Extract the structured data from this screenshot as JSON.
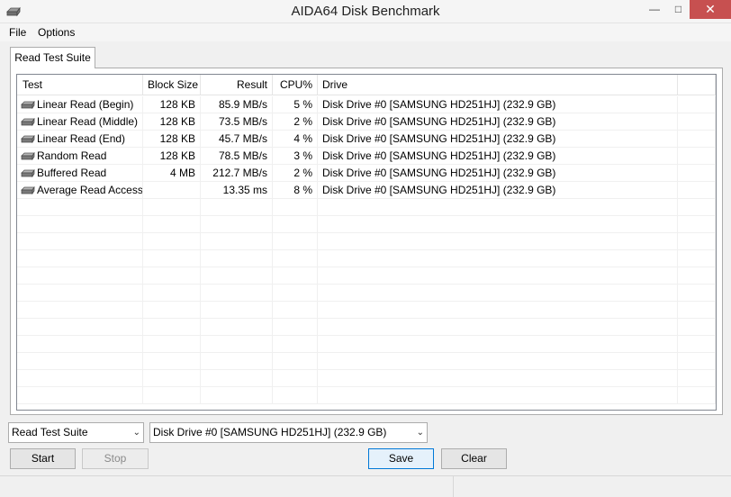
{
  "window": {
    "title": "AIDA64 Disk Benchmark"
  },
  "menu": {
    "file": "File",
    "options": "Options"
  },
  "tab": {
    "label": "Read Test Suite"
  },
  "table": {
    "headers": {
      "test": "Test",
      "block_size": "Block Size",
      "result": "Result",
      "cpu": "CPU%",
      "drive": "Drive"
    },
    "rows": [
      {
        "test": "Linear Read (Begin)",
        "block_size": "128 KB",
        "result": "85.9 MB/s",
        "cpu": "5 %",
        "drive": "Disk Drive #0  [SAMSUNG HD251HJ]  (232.9 GB)"
      },
      {
        "test": "Linear Read (Middle)",
        "block_size": "128 KB",
        "result": "73.5 MB/s",
        "cpu": "2 %",
        "drive": "Disk Drive #0  [SAMSUNG HD251HJ]  (232.9 GB)"
      },
      {
        "test": "Linear Read (End)",
        "block_size": "128 KB",
        "result": "45.7 MB/s",
        "cpu": "4 %",
        "drive": "Disk Drive #0  [SAMSUNG HD251HJ]  (232.9 GB)"
      },
      {
        "test": "Random Read",
        "block_size": "128 KB",
        "result": "78.5 MB/s",
        "cpu": "3 %",
        "drive": "Disk Drive #0  [SAMSUNG HD251HJ]  (232.9 GB)"
      },
      {
        "test": "Buffered Read",
        "block_size": "4 MB",
        "result": "212.7 MB/s",
        "cpu": "2 %",
        "drive": "Disk Drive #0  [SAMSUNG HD251HJ]  (232.9 GB)"
      },
      {
        "test": "Average Read Access",
        "block_size": "",
        "result": "13.35 ms",
        "cpu": "8 %",
        "drive": "Disk Drive #0  [SAMSUNG HD251HJ]  (232.9 GB)"
      }
    ]
  },
  "controls": {
    "suite_select": "Read Test Suite",
    "drive_select": "Disk Drive #0  [SAMSUNG HD251HJ]  (232.9 GB)",
    "start": "Start",
    "stop": "Stop",
    "save": "Save",
    "clear": "Clear"
  },
  "icons": {
    "app": "disk-drive-icon",
    "row": "hard-disk-icon",
    "minimize": "minimize-icon",
    "maximize": "maximize-icon",
    "close": "close-icon",
    "dropdown": "chevron-down-icon"
  },
  "colors": {
    "close_button": "#c75050",
    "accent": "#0078d7",
    "disabled_text": "#8a8a8a"
  }
}
